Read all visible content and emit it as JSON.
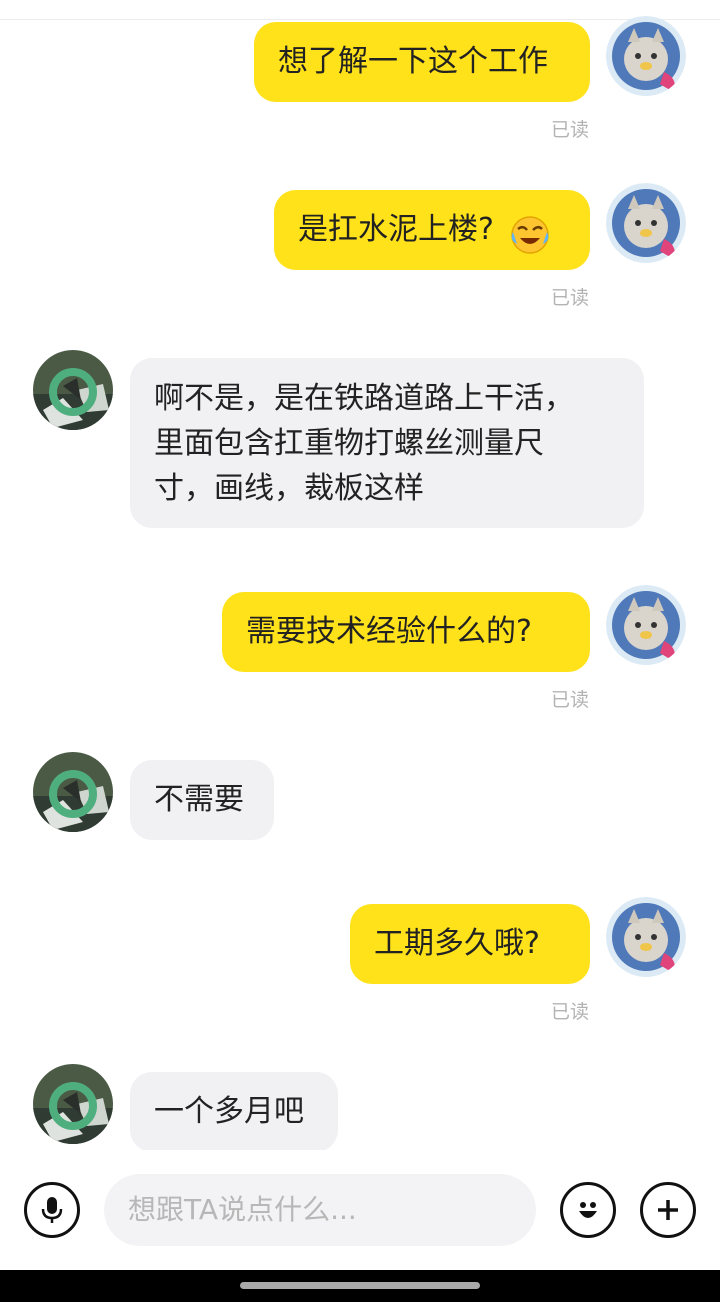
{
  "conversation": {
    "messages": [
      {
        "side": "me",
        "lines": [
          "想了解一下这个工作"
        ],
        "read": "已读"
      },
      {
        "side": "me",
        "lines": [
          "是扛水泥上楼?"
        ],
        "emoji": "crying-laughing-emoji",
        "read": "已读"
      },
      {
        "side": "them",
        "lines": [
          "啊不是，是在铁路道路上干活，",
          "里面包含扛重物打螺丝测量尺",
          "寸，画线，裁板这样"
        ]
      },
      {
        "side": "me",
        "lines": [
          "需要技术经验什么的?"
        ],
        "read": "已读"
      },
      {
        "side": "them",
        "lines": [
          "不需要"
        ]
      },
      {
        "side": "me",
        "lines": [
          "工期多久哦?"
        ],
        "read": "已读"
      },
      {
        "side": "them",
        "lines": [
          "一个多月吧"
        ]
      }
    ]
  },
  "input": {
    "placeholder": "想跟TA说点什么..."
  },
  "icons": {
    "voice": "microphone-icon",
    "emoji": "smiley-icon",
    "more": "plus-icon"
  },
  "colors": {
    "my_bubble": "#ffe21a",
    "their_bubble": "#f1f1f3",
    "read_text": "#b3b3b3"
  }
}
